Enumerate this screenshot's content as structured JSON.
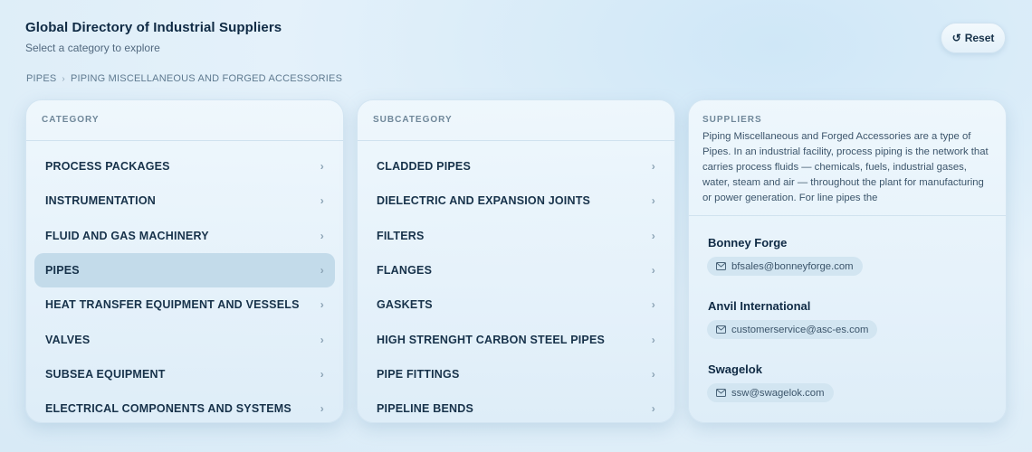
{
  "header": {
    "title": "Global Directory of Industrial Suppliers",
    "subtitle": "Select a category to explore",
    "reset_label": "Reset",
    "reset_icon": "refresh-icon"
  },
  "breadcrumb": [
    "PIPES",
    "PIPING MISCELLANEOUS AND FORGED ACCESSORIES"
  ],
  "category_panel": {
    "heading": "CATEGORY",
    "active_index": 3,
    "items": [
      "PROCESS PACKAGES",
      "INSTRUMENTATION",
      "FLUID AND GAS MACHINERY",
      "PIPES",
      "HEAT TRANSFER EQUIPMENT AND VESSELS",
      "VALVES",
      "SUBSEA EQUIPMENT",
      "ELECTRICAL COMPONENTS AND SYSTEMS"
    ]
  },
  "subcategory_panel": {
    "heading": "SUBCATEGORY",
    "items": [
      "CLADDED PIPES",
      "DIELECTRIC AND EXPANSION JOINTS",
      "FILTERS",
      "FLANGES",
      "GASKETS",
      "HIGH STRENGHT CARBON STEEL PIPES",
      "PIPE FITTINGS",
      "PIPELINE BENDS"
    ]
  },
  "suppliers_panel": {
    "heading": "SUPPLIERS",
    "description": "Piping Miscellaneous and Forged Accessories are a type of Pipes. In an industrial facility, process piping is the network that carries process fluids — chemicals, fuels, industrial gases, water, steam and air — throughout the plant for manufacturing or power generation. For line pipes the",
    "suppliers": [
      {
        "name": "Bonney Forge",
        "email": "bfsales@bonneyforge.com"
      },
      {
        "name": "Anvil International",
        "email": "customerservice@asc-es.com"
      },
      {
        "name": "Swagelok",
        "email": "ssw@swagelok.com"
      }
    ]
  },
  "icons": {
    "chevron": "chevron-right-icon",
    "mail": "mail-icon"
  },
  "colors": {
    "active_row": "#c3dbea",
    "title": "#0f2a44",
    "pill": "#d2e5f1"
  }
}
